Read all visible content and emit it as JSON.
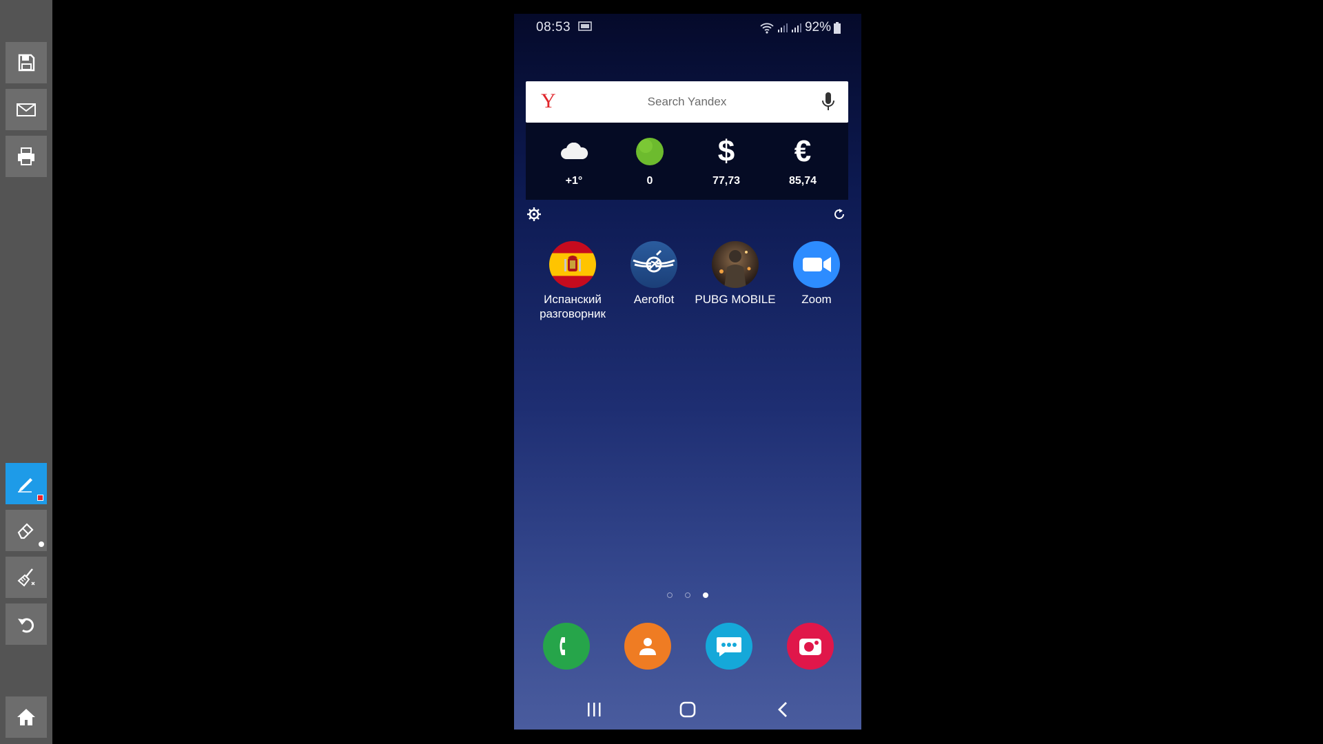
{
  "toolbar": {
    "items": [
      {
        "name": "save",
        "icon": "save-icon"
      },
      {
        "name": "email",
        "icon": "envelope-icon"
      },
      {
        "name": "print",
        "icon": "printer-icon"
      },
      {
        "name": "pen",
        "icon": "pen-icon",
        "active": true,
        "indicator_color": "#e8242a"
      },
      {
        "name": "eraser",
        "icon": "eraser-icon",
        "indicator_color": "#ffffff"
      },
      {
        "name": "clear",
        "icon": "broom-icon"
      },
      {
        "name": "undo",
        "icon": "undo-icon"
      },
      {
        "name": "home",
        "icon": "home-icon"
      }
    ],
    "active_color": "#1e9be8"
  },
  "phone": {
    "status_bar": {
      "time": "08:53",
      "battery": "92%"
    },
    "search": {
      "logo": "Y",
      "placeholder": "Search Yandex"
    },
    "info": {
      "weather": "+1°",
      "traffic": "0",
      "usd_symbol": "$",
      "usd": "77,73",
      "eur_symbol": "€",
      "eur": "85,74"
    },
    "apps": [
      {
        "label": "Испанский разговорник",
        "icon": "spain-flag-icon"
      },
      {
        "label": "Aeroflot",
        "icon": "aeroflot-icon"
      },
      {
        "label": "PUBG MOBILE",
        "icon": "pubg-icon"
      },
      {
        "label": "Zoom",
        "icon": "zoom-icon"
      }
    ],
    "page_indicator": {
      "count": 3,
      "active": 3
    },
    "dock": [
      {
        "name": "phone",
        "icon": "phone-icon",
        "color": "#26a54a"
      },
      {
        "name": "contacts",
        "icon": "contacts-icon",
        "color": "#ef7c23"
      },
      {
        "name": "messages",
        "icon": "messages-icon",
        "color": "#15a8d9"
      },
      {
        "name": "camera",
        "icon": "camera-icon",
        "color": "#e0174a"
      }
    ]
  }
}
